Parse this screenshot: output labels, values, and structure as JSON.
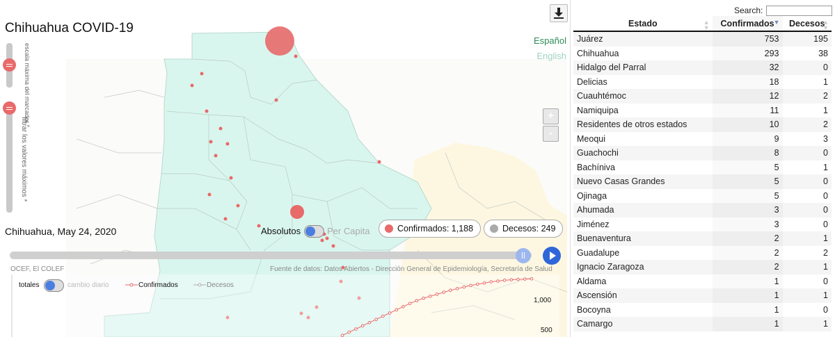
{
  "map": {
    "title": "Chihuahua COVID-19",
    "languages": {
      "active": "Español",
      "inactive": "English"
    },
    "zoom": {
      "in": "+",
      "out": "-"
    },
    "slider_labels": {
      "scale": "escala máxima del marcador *",
      "filter": "filtrar los valores máximos *"
    },
    "date": "Chihuahua, May 24, 2020",
    "toggle": {
      "left": "Absolutos",
      "right": "Per Capita"
    },
    "confirmed_pill": "Confirmados: 1,188",
    "deaths_pill": "Decesos: 249",
    "credit": "OCEF, El COLEF",
    "source": "Fuente de datos: Datos Abiertos - Dirección General de Epidemiología, Secretaría de Salud",
    "colors": {
      "state_fill": "#d9f6ee",
      "marker": "#e86a6a",
      "accent": "#2f66d8",
      "deaths": "#aaaaaa"
    }
  },
  "chart": {
    "toggle_left": "totales",
    "toggle_right": "cambio diario",
    "legend_confirmed": "Confirmados",
    "legend_deaths": "Decesos",
    "y_ticks": [
      "1,000",
      "500"
    ]
  },
  "chart_data": {
    "type": "line",
    "series": [
      {
        "name": "Confirmados",
        "x": [
          0,
          1,
          2,
          3,
          4,
          5,
          6,
          7,
          8,
          9,
          10,
          11,
          12,
          13,
          14,
          15,
          16,
          17,
          18,
          19,
          20,
          21,
          22,
          23,
          24,
          25,
          26,
          27,
          28
        ],
        "values": [
          480,
          520,
          560,
          600,
          640,
          680,
          720,
          760,
          800,
          840,
          880,
          915,
          945,
          970,
          995,
          1020,
          1045,
          1065,
          1085,
          1105,
          1120,
          1135,
          1150,
          1160,
          1170,
          1176,
          1181,
          1185,
          1188
        ]
      },
      {
        "name": "Decesos",
        "values": []
      }
    ],
    "y_ticks": [
      "1,000",
      "500"
    ]
  },
  "table": {
    "search_label": "Search:",
    "search_value": "",
    "columns": [
      "Estado",
      "Confirmados",
      "Decesos"
    ],
    "rows": [
      [
        "Juárez",
        "753",
        "195"
      ],
      [
        "Chihuahua",
        "293",
        "38"
      ],
      [
        "Hidalgo del Parral",
        "32",
        "0"
      ],
      [
        "Delicias",
        "18",
        "1"
      ],
      [
        "Cuauhtémoc",
        "12",
        "2"
      ],
      [
        "Namiquipa",
        "11",
        "1"
      ],
      [
        "Residentes de otros estados",
        "10",
        "2"
      ],
      [
        "Meoqui",
        "9",
        "3"
      ],
      [
        "Guachochi",
        "8",
        "0"
      ],
      [
        "Bachíniva",
        "5",
        "1"
      ],
      [
        "Nuevo Casas Grandes",
        "5",
        "0"
      ],
      [
        "Ojinaga",
        "5",
        "0"
      ],
      [
        "Ahumada",
        "3",
        "0"
      ],
      [
        "Jiménez",
        "3",
        "0"
      ],
      [
        "Buenaventura",
        "2",
        "1"
      ],
      [
        "Guadalupe",
        "2",
        "2"
      ],
      [
        "Ignacio Zaragoza",
        "2",
        "1"
      ],
      [
        "Aldama",
        "1",
        "0"
      ],
      [
        "Ascensión",
        "1",
        "1"
      ],
      [
        "Bocoyna",
        "1",
        "0"
      ],
      [
        "Camargo",
        "1",
        "1"
      ]
    ]
  }
}
